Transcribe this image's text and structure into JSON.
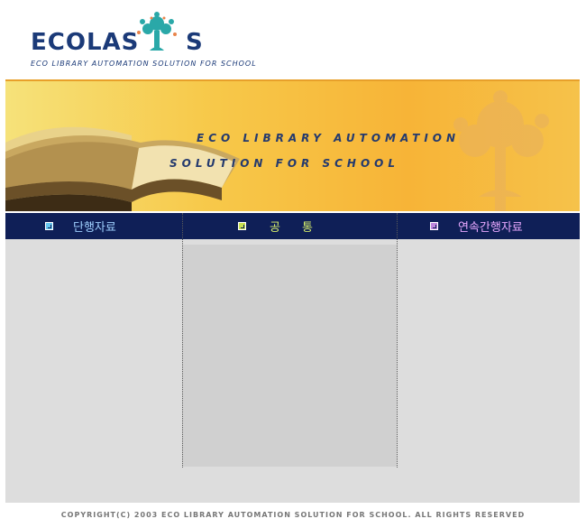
{
  "logo": {
    "name_left": "ECOLAS",
    "name_right": "S",
    "tagline": "ECO LIBRARY AUTOMATION SOLUTION FOR SCHOOL"
  },
  "banner": {
    "line1": "ECO LIBRARY AUTOMATION",
    "line2": "SOLUTION FOR SCHOOL"
  },
  "nav": {
    "items": [
      {
        "label": "단행자료"
      },
      {
        "label": "공통"
      },
      {
        "label": "연속간행자료"
      }
    ]
  },
  "footer": {
    "copyright": "COPYRIGHT(C) 2003 ECO LIBRARY AUTOMATION SOLUTION FOR SCHOOL. ALL RIGHTS RESERVED"
  },
  "colors": {
    "navy": "#0f1f57",
    "banner_orange": "#f7b437",
    "logo_blue": "#1b3a78",
    "logo_teal": "#2aa8a8"
  }
}
